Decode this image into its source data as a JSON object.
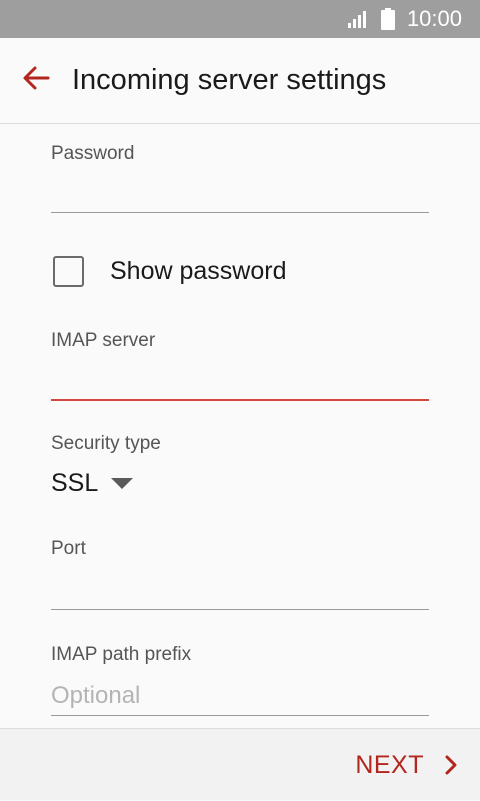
{
  "status_bar": {
    "time": "10:00",
    "icons": [
      "signal-icon",
      "battery-icon"
    ]
  },
  "app_bar": {
    "title": "Incoming server settings",
    "back_icon": "arrow-back-icon"
  },
  "form": {
    "password": {
      "label": "Password",
      "value": "",
      "placeholder": ""
    },
    "show_password": {
      "label": "Show password",
      "checked": false
    },
    "imap_server": {
      "label": "IMAP server",
      "value": "",
      "placeholder": ""
    },
    "security_type": {
      "label": "Security type",
      "value": "SSL"
    },
    "port": {
      "label": "Port",
      "value": "",
      "placeholder": ""
    },
    "imap_path_prefix": {
      "label": "IMAP path prefix",
      "value": "",
      "placeholder": "Optional"
    }
  },
  "bottom_bar": {
    "next_label": "NEXT",
    "next_icon": "chevron-right-icon"
  },
  "colors": {
    "accent": "#b3261e",
    "focus_underline": "#d0483e",
    "status_bar": "#9e9e9e"
  }
}
